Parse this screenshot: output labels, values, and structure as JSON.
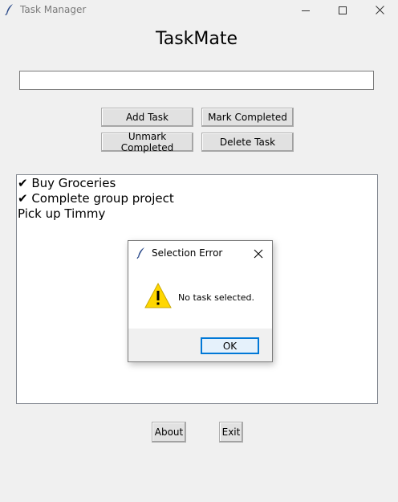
{
  "window": {
    "title": "Task Manager"
  },
  "app": {
    "heading": "TaskMate",
    "task_input_value": ""
  },
  "buttons": {
    "add": "Add Task",
    "mark": "Mark Completed",
    "unmark": "Unmark Completed",
    "delete": "Delete Task",
    "about": "About",
    "exit": "Exit"
  },
  "tasks": [
    {
      "text": "✔ Buy Groceries"
    },
    {
      "text": "✔ Complete group project"
    },
    {
      "text": "Pick up Timmy"
    }
  ],
  "dialog": {
    "title": "Selection Error",
    "message": "No task selected.",
    "ok_label": "OK"
  },
  "colors": {
    "window_bg": "#f0f0f0",
    "focus_accent": "#0078d7",
    "warning_yellow": "#ffd700"
  },
  "icons": {
    "app": "feather-icon",
    "minimize": "minimize-icon",
    "maximize": "maximize-icon",
    "close": "close-icon",
    "warning": "warning-icon"
  }
}
